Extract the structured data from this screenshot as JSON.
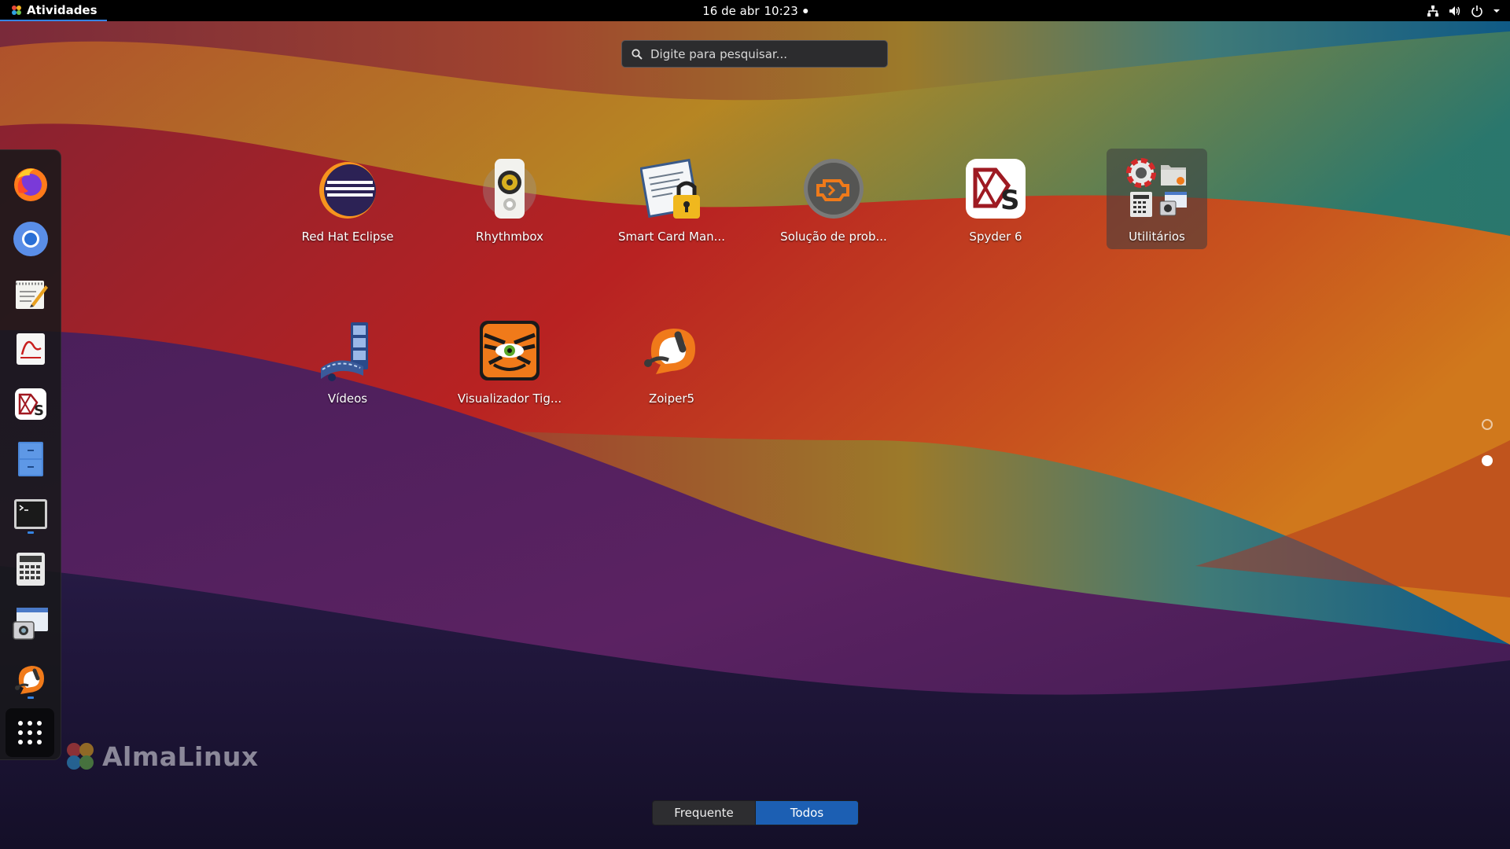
{
  "topbar": {
    "activities_label": "Atividades",
    "date": "16 de abr",
    "time": "10:23",
    "tray_icons": [
      "network-icon",
      "volume-icon",
      "power-icon",
      "chevron-down-icon"
    ]
  },
  "search": {
    "placeholder": "Digite para pesquisar..."
  },
  "dash": {
    "items": [
      {
        "name": "firefox",
        "running": false
      },
      {
        "name": "chromium",
        "running": false
      },
      {
        "name": "text-editor",
        "running": false
      },
      {
        "name": "document-viewer",
        "running": false
      },
      {
        "name": "spyder",
        "running": false
      },
      {
        "name": "file-cabinet",
        "running": false
      },
      {
        "name": "terminal",
        "running": true
      },
      {
        "name": "calculator",
        "running": false
      },
      {
        "name": "screenshot",
        "running": false
      },
      {
        "name": "zoiper",
        "running": true
      }
    ],
    "show_apps_icon": "grid-icon"
  },
  "apps": [
    {
      "label": "Red Hat Eclipse",
      "icon": "eclipse-icon"
    },
    {
      "label": "Rhythmbox",
      "icon": "rhythmbox-icon"
    },
    {
      "label": "Smart Card Man...",
      "icon": "smart-card-icon"
    },
    {
      "label": "Solução de prob...",
      "icon": "troubleshoot-icon"
    },
    {
      "label": "Spyder 6",
      "icon": "spyder-icon"
    },
    {
      "label": "Utilitários",
      "icon": "folder-icon"
    },
    {
      "label": "Vídeos",
      "icon": "videos-icon"
    },
    {
      "label": "Visualizador Tig...",
      "icon": "tiger-viewer-icon"
    },
    {
      "label": "Zoiper5",
      "icon": "zoiper-icon"
    }
  ],
  "pages": {
    "count": 2,
    "current": 2
  },
  "brand": "AlmaLinux",
  "view_toggle": {
    "frequent": "Frequente",
    "all": "Todos",
    "selected": "all"
  }
}
